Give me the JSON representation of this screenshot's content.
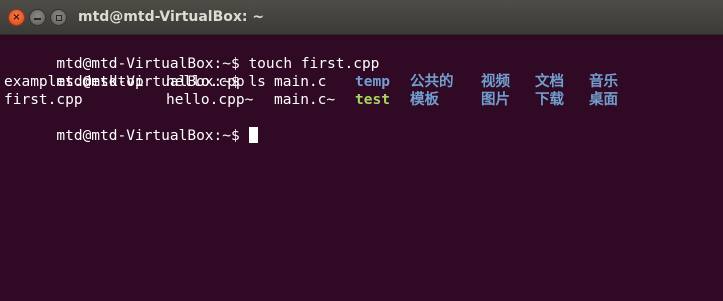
{
  "window": {
    "title": "mtd@mtd-VirtualBox: ~",
    "buttons": {
      "close_glyph": "×",
      "minimize_icon": "minimize-icon",
      "maximize_icon": "maximize-icon"
    }
  },
  "terminal": {
    "colors": {
      "background": "#300a24",
      "foreground": "#ffffff",
      "directory_blue": "#729fcf",
      "directory_green_highlight": "#a8d65c"
    },
    "lines": [
      {
        "prompt": "mtd@mtd-VirtualBox:~$",
        "command": "touch first.cpp"
      },
      {
        "prompt": "mtd@mtd-VirtualBox:~$",
        "command": "ls"
      }
    ],
    "ls_output": {
      "row1": [
        "examples.desktop",
        "hello.cpp",
        "main.c",
        "temp",
        "公共的",
        "视频",
        "文档",
        "音乐"
      ],
      "row2": [
        "first.cpp",
        "hello.cpp~",
        "main.c~",
        "test",
        "模板",
        "图片",
        "下载",
        "桌面"
      ]
    },
    "current_prompt": "mtd@mtd-VirtualBox:~$"
  }
}
